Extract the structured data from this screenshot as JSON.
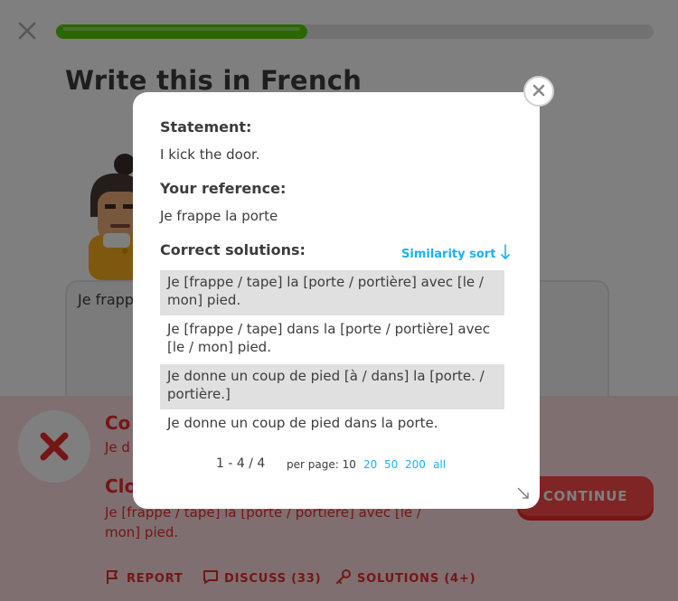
{
  "lesson": {
    "title": "Write this in French",
    "progress_fraction": 0.42,
    "answer_text": "Je frapp"
  },
  "feedback": {
    "correct_heading": "Co",
    "correct_text": "Je d",
    "close_heading": "Clo",
    "close_solution": "Je [frappe / tape] la [porte / portière] avec [le / mon] pied.",
    "continue_label": "CONTINUE",
    "actions": [
      {
        "label": "REPORT",
        "icon": "flag-icon"
      },
      {
        "label": "DISCUSS (33)",
        "icon": "chat-bubble-icon"
      },
      {
        "label": "SOLUTIONS (4+)",
        "icon": "key-icon"
      }
    ]
  },
  "modal": {
    "statement_label": "Statement:",
    "statement_text": "I kick the door.",
    "reference_label": "Your reference:",
    "reference_text": "Je frappe la porte",
    "solutions_label": "Correct solutions:",
    "sort_label": "Similarity sort",
    "sort_icon": "arrow-down-icon",
    "solutions": [
      "Je [frappe / tape] la [porte / portière] avec [le / mon] pied.",
      "Je [frappe / tape] dans la [porte / portière] avec [le / mon] pied.",
      "Je donne un coup de pied [à / dans] la [porte. / portière.]",
      "Je donne un coup de pied dans la porte."
    ],
    "pagination": {
      "range": "1 - 4 / 4",
      "per_page_label": "per page: 10",
      "options": [
        "20",
        "50",
        "200",
        "all"
      ]
    }
  },
  "colors": {
    "progress_green": "#58cc02",
    "error_red": "#ea2b2b",
    "error_bg": "#ffdfe0",
    "link_blue": "#1cb0f6",
    "row_alt_bg": "#e0e0e0"
  }
}
